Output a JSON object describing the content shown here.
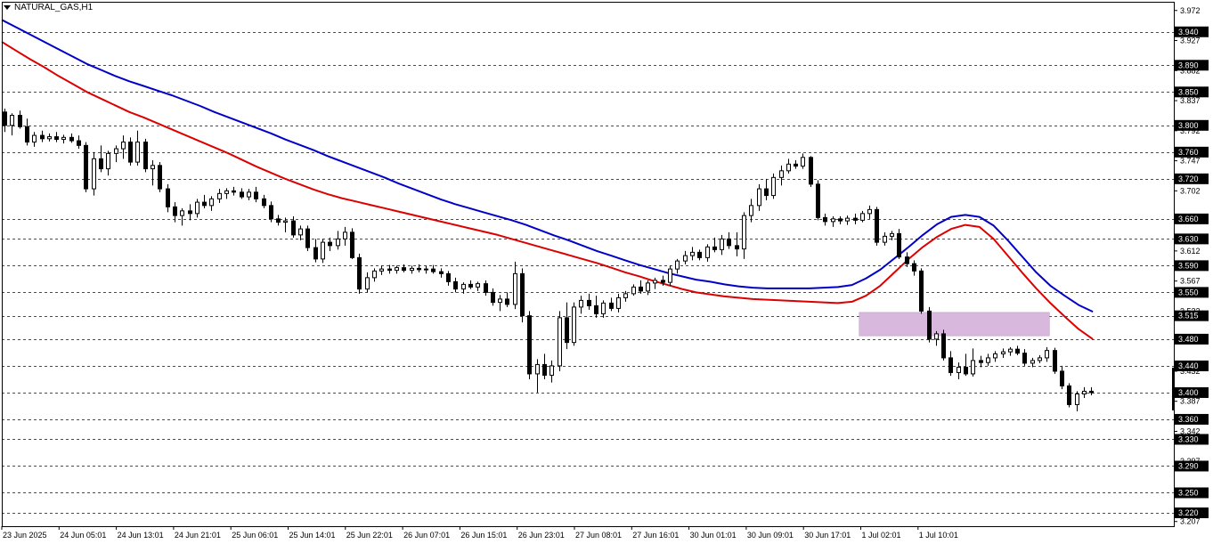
{
  "symbol": {
    "text": "NATURAL_GAS,H1"
  },
  "colors": {
    "background": "#ffffff",
    "frame": "#000000",
    "grid": "#4a4a4a",
    "candle": "#000000",
    "ema_slow": "#0000c8",
    "ema_fast": "#dc0000",
    "zone_fill": "#d8b8dc",
    "label_bg": "#000000",
    "label_text": "#ffffff"
  },
  "chart_data": {
    "type": "candlestick",
    "ylim": [
      3.2,
      3.985
    ],
    "grid": "horizontal dashed",
    "price_ticks": [
      "3.972",
      "3.927",
      "3.882",
      "3.837",
      "3.792",
      "3.747",
      "3.702",
      "3.657",
      "3.612",
      "3.567",
      "3.522",
      "3.477",
      "3.432",
      "3.387",
      "3.342",
      "3.297",
      "3.252",
      "3.207"
    ],
    "level_labels": [
      "3.940",
      "3.890",
      "3.850",
      "3.800",
      "3.760",
      "3.720",
      "3.660",
      "3.630",
      "3.590",
      "3.550",
      "3.515",
      "3.480",
      "3.440",
      "3.400",
      "3.360",
      "3.330",
      "3.290",
      "3.250",
      "3.220"
    ],
    "time_labels": [
      "23 Jun 2025",
      "24 Jun 05:01",
      "24 Jun 13:01",
      "24 Jun 21:01",
      "25 Jun 06:01",
      "25 Jun 14:01",
      "25 Jun 22:01",
      "26 Jun 07:01",
      "26 Jun 15:01",
      "26 Jun 23:01",
      "27 Jun 08:01",
      "27 Jun 16:01",
      "30 Jun 01:01",
      "30 Jun 09:01",
      "30 Jun 17:01",
      "1 Jul 02:01",
      "1 Jul 10:01"
    ],
    "candles": [
      [
        3.82,
        3.825,
        3.79,
        3.8
      ],
      [
        3.8,
        3.818,
        3.785,
        3.815
      ],
      [
        3.815,
        3.822,
        3.795,
        3.798
      ],
      [
        3.798,
        3.81,
        3.77,
        3.775
      ],
      [
        3.775,
        3.79,
        3.768,
        3.785
      ],
      [
        3.785,
        3.792,
        3.775,
        3.78
      ],
      [
        3.78,
        3.788,
        3.776,
        3.783
      ],
      [
        3.783,
        3.79,
        3.775,
        3.779
      ],
      [
        3.779,
        3.786,
        3.773,
        3.782
      ],
      [
        3.782,
        3.788,
        3.774,
        3.777
      ],
      [
        3.777,
        3.785,
        3.765,
        3.77
      ],
      [
        3.77,
        3.775,
        3.7,
        3.705
      ],
      [
        3.705,
        3.76,
        3.695,
        3.75
      ],
      [
        3.75,
        3.77,
        3.73,
        3.735
      ],
      [
        3.735,
        3.762,
        3.725,
        3.758
      ],
      [
        3.758,
        3.77,
        3.745,
        3.765
      ],
      [
        3.765,
        3.785,
        3.75,
        3.775
      ],
      [
        3.775,
        3.782,
        3.74,
        3.745
      ],
      [
        3.745,
        3.792,
        3.74,
        3.775
      ],
      [
        3.775,
        3.78,
        3.73,
        3.735
      ],
      [
        3.735,
        3.748,
        3.71,
        3.74
      ],
      [
        3.74,
        3.745,
        3.7,
        3.705
      ],
      [
        3.705,
        3.712,
        3.67,
        3.678
      ],
      [
        3.678,
        3.685,
        3.655,
        3.665
      ],
      [
        3.665,
        3.676,
        3.65,
        3.672
      ],
      [
        3.672,
        3.682,
        3.658,
        3.668
      ],
      [
        3.668,
        3.69,
        3.662,
        3.685
      ],
      [
        3.685,
        3.696,
        3.676,
        3.68
      ],
      [
        3.68,
        3.694,
        3.672,
        3.69
      ],
      [
        3.69,
        3.705,
        3.684,
        3.698
      ],
      [
        3.698,
        3.706,
        3.69,
        3.702
      ],
      [
        3.702,
        3.708,
        3.695,
        3.7
      ],
      [
        3.7,
        3.706,
        3.69,
        3.693
      ],
      [
        3.693,
        3.705,
        3.688,
        3.7
      ],
      [
        3.7,
        3.708,
        3.685,
        3.69
      ],
      [
        3.69,
        3.696,
        3.676,
        3.68
      ],
      [
        3.68,
        3.686,
        3.655,
        3.66
      ],
      [
        3.66,
        3.666,
        3.65,
        3.655
      ],
      [
        3.655,
        3.662,
        3.64,
        3.657
      ],
      [
        3.657,
        3.664,
        3.632,
        3.636
      ],
      [
        3.636,
        3.65,
        3.628,
        3.645
      ],
      [
        3.645,
        3.65,
        3.612,
        3.617
      ],
      [
        3.617,
        3.63,
        3.595,
        3.6
      ],
      [
        3.6,
        3.63,
        3.594,
        3.625
      ],
      [
        3.625,
        3.632,
        3.612,
        3.62
      ],
      [
        3.62,
        3.642,
        3.614,
        3.63
      ],
      [
        3.63,
        3.648,
        3.62,
        3.64
      ],
      [
        3.64,
        3.646,
        3.6,
        3.602
      ],
      [
        3.602,
        3.608,
        3.548,
        3.555
      ],
      [
        3.555,
        3.58,
        3.55,
        3.572
      ],
      [
        3.572,
        3.586,
        3.566,
        3.582
      ],
      [
        3.582,
        3.59,
        3.576,
        3.585
      ],
      [
        3.585,
        3.591,
        3.578,
        3.583
      ],
      [
        3.583,
        3.59,
        3.578,
        3.587
      ],
      [
        3.587,
        3.592,
        3.58,
        3.583
      ],
      [
        3.583,
        3.59,
        3.578,
        3.586
      ],
      [
        3.586,
        3.592,
        3.58,
        3.584
      ],
      [
        3.584,
        3.59,
        3.578,
        3.585
      ],
      [
        3.585,
        3.591,
        3.578,
        3.581
      ],
      [
        3.581,
        3.586,
        3.572,
        3.578
      ],
      [
        3.578,
        3.582,
        3.56,
        3.566
      ],
      [
        3.566,
        3.572,
        3.55,
        3.555
      ],
      [
        3.555,
        3.565,
        3.548,
        3.562
      ],
      [
        3.562,
        3.568,
        3.555,
        3.558
      ],
      [
        3.558,
        3.566,
        3.552,
        3.563
      ],
      [
        3.563,
        3.568,
        3.545,
        3.55
      ],
      [
        3.55,
        3.556,
        3.53,
        3.535
      ],
      [
        3.535,
        3.546,
        3.522,
        3.54
      ],
      [
        3.54,
        3.55,
        3.528,
        3.532
      ],
      [
        3.532,
        3.596,
        3.525,
        3.578
      ],
      [
        3.578,
        3.586,
        3.505,
        3.515
      ],
      [
        3.515,
        3.522,
        3.42,
        3.428
      ],
      [
        3.428,
        3.45,
        3.4,
        3.442
      ],
      [
        3.442,
        3.458,
        3.42,
        3.426
      ],
      [
        3.426,
        3.448,
        3.415,
        3.44
      ],
      [
        3.44,
        3.522,
        3.432,
        3.512
      ],
      [
        3.512,
        3.535,
        3.465,
        3.475
      ],
      [
        3.475,
        3.535,
        3.47,
        3.528
      ],
      [
        3.528,
        3.545,
        3.518,
        3.538
      ],
      [
        3.538,
        3.548,
        3.524,
        3.53
      ],
      [
        3.53,
        3.545,
        3.512,
        3.518
      ],
      [
        3.518,
        3.538,
        3.512,
        3.534
      ],
      [
        3.534,
        3.542,
        3.522,
        3.526
      ],
      [
        3.526,
        3.548,
        3.52,
        3.542
      ],
      [
        3.542,
        3.552,
        3.536,
        3.548
      ],
      [
        3.548,
        3.562,
        3.545,
        3.558
      ],
      [
        3.558,
        3.568,
        3.548,
        3.552
      ],
      [
        3.552,
        3.568,
        3.546,
        3.564
      ],
      [
        3.564,
        3.572,
        3.555,
        3.568
      ],
      [
        3.568,
        3.575,
        3.56,
        3.565
      ],
      [
        3.565,
        3.59,
        3.56,
        3.585
      ],
      [
        3.585,
        3.6,
        3.578,
        3.597
      ],
      [
        3.597,
        3.612,
        3.592,
        3.605
      ],
      [
        3.605,
        3.618,
        3.598,
        3.61
      ],
      [
        3.61,
        3.614,
        3.598,
        3.602
      ],
      [
        3.602,
        3.622,
        3.596,
        3.618
      ],
      [
        3.618,
        3.632,
        3.61,
        3.614
      ],
      [
        3.614,
        3.636,
        3.606,
        3.63
      ],
      [
        3.63,
        3.64,
        3.615,
        3.62
      ],
      [
        3.62,
        3.64,
        3.604,
        3.615
      ],
      [
        3.615,
        3.67,
        3.6,
        3.665
      ],
      [
        3.665,
        3.69,
        3.655,
        3.68
      ],
      [
        3.68,
        3.712,
        3.672,
        3.705
      ],
      [
        3.705,
        3.72,
        3.688,
        3.695
      ],
      [
        3.695,
        3.728,
        3.69,
        3.722
      ],
      [
        3.722,
        3.74,
        3.71,
        3.732
      ],
      [
        3.732,
        3.75,
        3.728,
        3.742
      ],
      [
        3.742,
        3.748,
        3.735,
        3.739
      ],
      [
        3.739,
        3.758,
        3.735,
        3.752
      ],
      [
        3.752,
        3.754,
        3.708,
        3.712
      ],
      [
        3.712,
        3.718,
        3.658,
        3.662
      ],
      [
        3.662,
        3.668,
        3.65,
        3.656
      ],
      [
        3.656,
        3.664,
        3.648,
        3.66
      ],
      [
        3.66,
        3.664,
        3.652,
        3.657
      ],
      [
        3.657,
        3.665,
        3.651,
        3.661
      ],
      [
        3.661,
        3.668,
        3.652,
        3.658
      ],
      [
        3.658,
        3.672,
        3.655,
        3.668
      ],
      [
        3.668,
        3.68,
        3.66,
        3.674
      ],
      [
        3.674,
        3.678,
        3.62,
        3.625
      ],
      [
        3.625,
        3.64,
        3.62,
        3.634
      ],
      [
        3.634,
        3.642,
        3.628,
        3.638
      ],
      [
        3.638,
        3.645,
        3.6,
        3.603
      ],
      [
        3.603,
        3.61,
        3.588,
        3.593
      ],
      [
        3.593,
        3.598,
        3.575,
        3.582
      ],
      [
        3.582,
        3.586,
        3.518,
        3.522
      ],
      [
        3.522,
        3.528,
        3.475,
        3.48
      ],
      [
        3.48,
        3.492,
        3.47,
        3.488
      ],
      [
        3.488,
        3.494,
        3.448,
        3.452
      ],
      [
        3.452,
        3.462,
        3.425,
        3.43
      ],
      [
        3.43,
        3.445,
        3.42,
        3.438
      ],
      [
        3.438,
        3.458,
        3.425,
        3.428
      ],
      [
        3.428,
        3.466,
        3.424,
        3.448
      ],
      [
        3.448,
        3.455,
        3.438,
        3.445
      ],
      [
        3.445,
        3.458,
        3.44,
        3.452
      ],
      [
        3.452,
        3.462,
        3.446,
        3.458
      ],
      [
        3.458,
        3.466,
        3.452,
        3.461
      ],
      [
        3.461,
        3.468,
        3.455,
        3.465
      ],
      [
        3.465,
        3.47,
        3.456,
        3.459
      ],
      [
        3.459,
        3.465,
        3.44,
        3.444
      ],
      [
        3.444,
        3.452,
        3.438,
        3.448
      ],
      [
        3.448,
        3.456,
        3.444,
        3.452
      ],
      [
        3.452,
        3.468,
        3.446,
        3.463
      ],
      [
        3.463,
        3.467,
        3.428,
        3.432
      ],
      [
        3.432,
        3.44,
        3.405,
        3.41
      ],
      [
        3.41,
        3.414,
        3.378,
        3.382
      ],
      [
        3.382,
        3.402,
        3.372,
        3.398
      ],
      [
        3.398,
        3.408,
        3.392,
        3.402
      ],
      [
        3.402,
        3.408,
        3.396,
        3.4
      ]
    ],
    "series": [
      {
        "values": [
          3.925,
          3.912,
          3.899,
          3.887,
          3.874,
          3.862,
          3.85,
          3.84,
          3.83,
          3.82,
          3.812,
          3.803,
          3.794,
          3.785,
          3.776,
          3.767,
          3.758,
          3.748,
          3.738,
          3.729,
          3.72,
          3.712,
          3.704,
          3.697,
          3.691,
          3.686,
          3.681,
          3.676,
          3.671,
          3.666,
          3.661,
          3.656,
          3.651,
          3.646,
          3.641,
          3.636,
          3.63,
          3.624,
          3.618,
          3.612,
          3.606,
          3.6,
          3.594,
          3.587,
          3.58,
          3.574,
          3.567,
          3.561,
          3.555,
          3.55,
          3.547,
          3.544,
          3.542,
          3.54,
          3.539,
          3.538,
          3.537,
          3.536,
          3.535,
          3.534,
          3.536,
          3.545,
          3.56,
          3.58,
          3.6,
          3.618,
          3.633,
          3.645,
          3.651,
          3.648,
          3.63,
          3.605,
          3.58,
          3.556,
          3.534,
          3.514,
          3.495,
          3.48
        ]
      },
      {
        "values": [
          3.958,
          3.947,
          3.936,
          3.925,
          3.914,
          3.903,
          3.892,
          3.883,
          3.874,
          3.866,
          3.859,
          3.852,
          3.845,
          3.837,
          3.829,
          3.82,
          3.812,
          3.804,
          3.796,
          3.788,
          3.779,
          3.771,
          3.763,
          3.754,
          3.746,
          3.738,
          3.73,
          3.722,
          3.713,
          3.705,
          3.697,
          3.689,
          3.682,
          3.676,
          3.67,
          3.664,
          3.658,
          3.651,
          3.643,
          3.635,
          3.628,
          3.62,
          3.612,
          3.605,
          3.598,
          3.591,
          3.585,
          3.579,
          3.574,
          3.569,
          3.566,
          3.562,
          3.559,
          3.557,
          3.556,
          3.556,
          3.556,
          3.556,
          3.557,
          3.558,
          3.561,
          3.571,
          3.584,
          3.601,
          3.618,
          3.636,
          3.652,
          3.663,
          3.666,
          3.663,
          3.65,
          3.628,
          3.604,
          3.58,
          3.56,
          3.545,
          3.531,
          3.521
        ]
      }
    ],
    "zone": {
      "y_from": 3.485,
      "y_to": 3.52,
      "from_candle": 116,
      "to_candle": 141
    }
  }
}
